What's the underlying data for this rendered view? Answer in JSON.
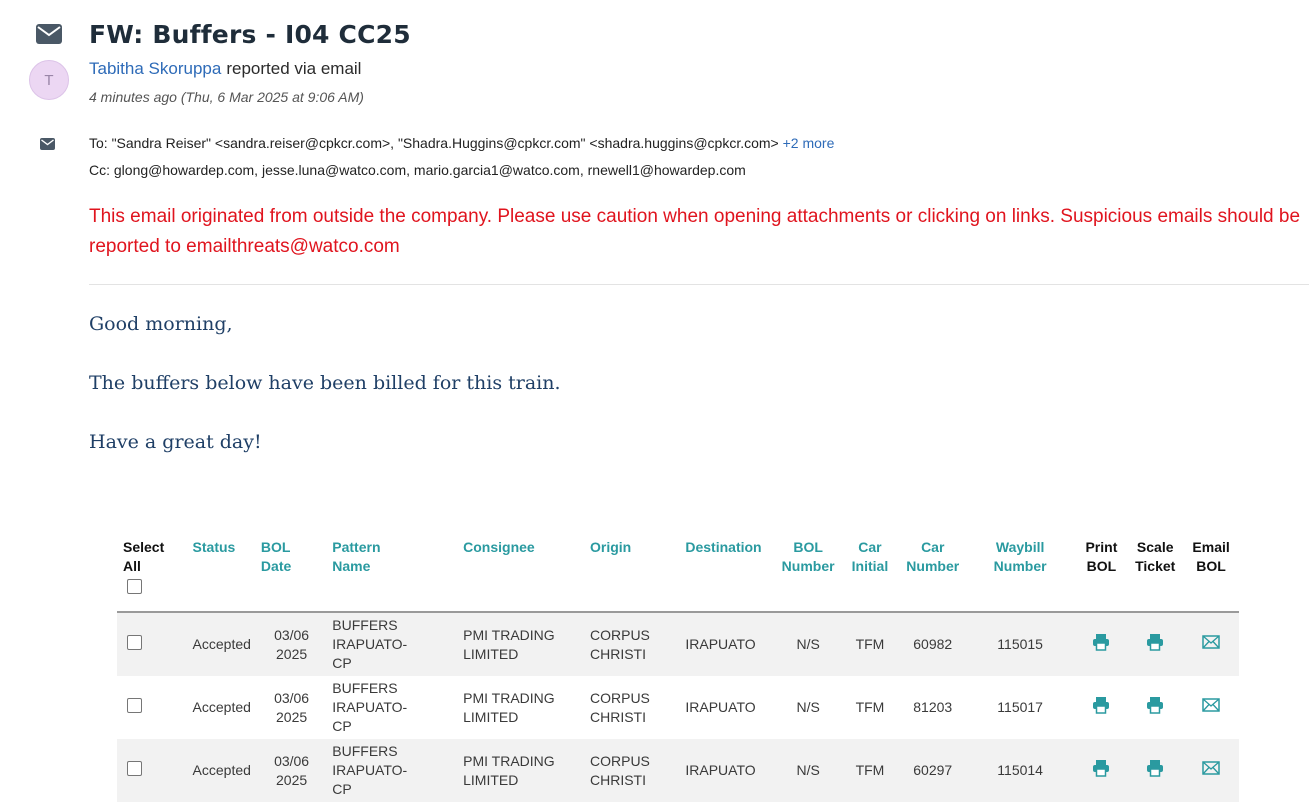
{
  "email": {
    "subject": "FW: Buffers - I04 CC25",
    "avatar_initial": "T",
    "sender_name": "Tabitha Skoruppa",
    "sender_suffix": "reported via email",
    "timestamp": "4 minutes ago (Thu, 6 Mar 2025 at 9:06 AM)",
    "to_label": "To:",
    "to_value": "\"Sandra Reiser\" <sandra.reiser@cpkcr.com>, \"Shadra.Huggins@cpkcr.com\" <shadra.huggins@cpkcr.com>",
    "to_more": "+2 more",
    "cc_label": "Cc:",
    "cc_value": "glong@howardep.com, jesse.luna@watco.com, mario.garcia1@watco.com, rnewell1@howardep.com",
    "warning_line1": "This email originated from outside the company. Please use caution when opening attachments or clicking on links. Suspicious emails should be",
    "warning_line2": "reported to emailthreats@watco.com",
    "body_greeting": "Good morning,",
    "body_main": "The buffers below have been billed for this train.",
    "body_closing": "Have a great day!"
  },
  "table": {
    "headers": {
      "select_all_1": "Select",
      "select_all_2": "All",
      "status": "Status",
      "bol_date_1": "BOL",
      "bol_date_2": "Date",
      "pattern_1": "Pattern",
      "pattern_2": "Name",
      "consignee": "Consignee",
      "origin": "Origin",
      "destination": "Destination",
      "bol_number_1": "BOL",
      "bol_number_2": "Number",
      "car_initial_1": "Car",
      "car_initial_2": "Initial",
      "car_number_1": "Car",
      "car_number_2": "Number",
      "waybill_1": "Waybill",
      "waybill_2": "Number",
      "print_bol_1": "Print",
      "print_bol_2": "BOL",
      "scale_1": "Scale",
      "scale_2": "Ticket",
      "email_bol_1": "Email",
      "email_bol_2": "BOL"
    },
    "rows": [
      {
        "status": "Accepted",
        "date_1": "03/06",
        "date_2": "2025",
        "pattern_1": "BUFFERS IRAPUATO-",
        "pattern_2": "CP",
        "consignee_1": "PMI TRADING",
        "consignee_2": "LIMITED",
        "origin_1": "CORPUS",
        "origin_2": "CHRISTI",
        "destination": "IRAPUATO",
        "bol_number": "N/S",
        "car_initial": "TFM",
        "car_number": "60982",
        "waybill": "115015"
      },
      {
        "status": "Accepted",
        "date_1": "03/06",
        "date_2": "2025",
        "pattern_1": "BUFFERS IRAPUATO-",
        "pattern_2": "CP",
        "consignee_1": "PMI TRADING",
        "consignee_2": "LIMITED",
        "origin_1": "CORPUS",
        "origin_2": "CHRISTI",
        "destination": "IRAPUATO",
        "bol_number": "N/S",
        "car_initial": "TFM",
        "car_number": "81203",
        "waybill": "115017"
      },
      {
        "status": "Accepted",
        "date_1": "03/06",
        "date_2": "2025",
        "pattern_1": "BUFFERS IRAPUATO-",
        "pattern_2": "CP",
        "consignee_1": "PMI TRADING",
        "consignee_2": "LIMITED",
        "origin_1": "CORPUS",
        "origin_2": "CHRISTI",
        "destination": "IRAPUATO",
        "bol_number": "N/S",
        "car_initial": "TFM",
        "car_number": "60297",
        "waybill": "115014"
      }
    ]
  },
  "colors": {
    "accent_teal": "#2a9aa0",
    "warning_red": "#e0141e",
    "link_blue": "#2e6bb8",
    "body_navy": "#1f3f66"
  },
  "icons": {
    "envelope": "envelope-icon",
    "printer": "printer-icon",
    "mail": "mail-icon"
  }
}
